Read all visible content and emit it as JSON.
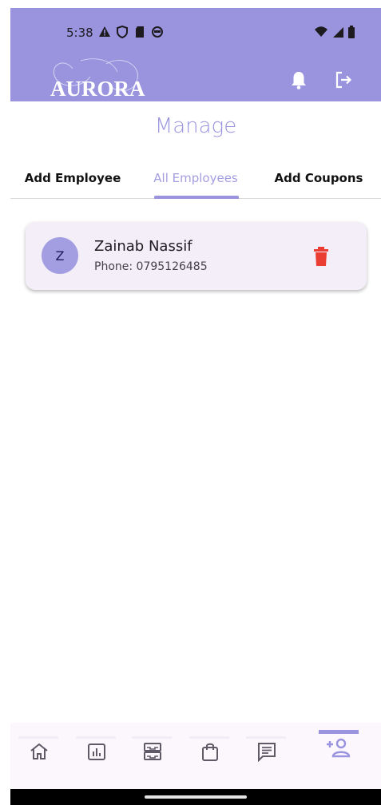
{
  "status_bar": {
    "time": "5:38",
    "icons_left": [
      "warning-icon",
      "shield-icon",
      "sd-card-icon",
      "recorder-icon"
    ],
    "icons_right": [
      "wifi-icon",
      "signal-icon",
      "battery-icon"
    ]
  },
  "header": {
    "logo_text": "AURORA",
    "bell_icon": "bell-icon",
    "logout_icon": "logout-icon",
    "background": "#9a94df"
  },
  "page": {
    "title": "Manage"
  },
  "tabs": [
    {
      "label": "Add Employee",
      "active": false
    },
    {
      "label": "All Employees",
      "active": true
    },
    {
      "label": "Add Coupons",
      "active": false
    }
  ],
  "employees": [
    {
      "initial": "Z",
      "name": "Zainab Nassif",
      "phone": "Phone: 0795126485"
    }
  ],
  "bottom_nav": [
    {
      "icon": "home-icon",
      "active": false
    },
    {
      "icon": "stats-icon",
      "active": false
    },
    {
      "icon": "inventory-icon",
      "active": false
    },
    {
      "icon": "shopping-bag-icon",
      "active": false
    },
    {
      "icon": "message-icon",
      "active": false
    },
    {
      "icon": "add-person-icon",
      "active": true
    }
  ],
  "colors": {
    "accent": "#9a94df",
    "delete": "#ea3d33",
    "card": "#f3eef8"
  }
}
